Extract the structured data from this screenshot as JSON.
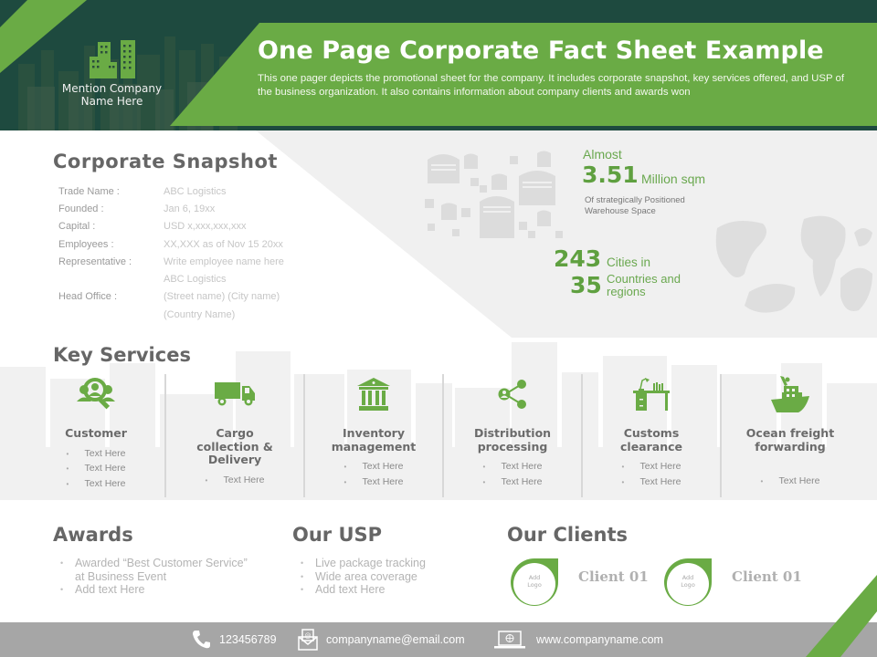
{
  "header": {
    "company_name": "Mention Company Name Here",
    "title": "One Page Corporate Fact Sheet Example",
    "intro": "This one pager depicts the promotional sheet for the company. It includes corporate snapshot, key services offered, and USP of the business organization. It also contains information about company clients and awards won",
    "logo_icon": "buildings-icon"
  },
  "snapshot": {
    "title": "Corporate  Snapshot",
    "rows": [
      {
        "label": "Trade Name :",
        "value": "ABC Logistics"
      },
      {
        "label": "Founded :",
        "value": "Jan 6, 19xx"
      },
      {
        "label": "Capital :",
        "value": "USD x,xxx,xxx,xxx"
      },
      {
        "label": "Employees :",
        "value": "XX,XXX as of Nov 15 20xx"
      },
      {
        "label": "Representative :",
        "value": "Write employee name here"
      },
      {
        "label": "",
        "value": "ABC Logistics"
      },
      {
        "label": "Head Office :",
        "value": "(Street name) (City name)"
      },
      {
        "label": "",
        "value": "(Country Name)"
      }
    ]
  },
  "stats": {
    "almost_label": "Almost",
    "warehouse_value": "3.51",
    "warehouse_unit": "Million  sqm",
    "warehouse_desc": "Of strategically Positioned Warehouse Space",
    "cities_value": "243",
    "cities_label": "Cities  in",
    "countries_value": "35",
    "countries_label": "Countries and regions",
    "warehouse_icon": "warehouse-icon",
    "map_icon": "world-map-icon"
  },
  "services": {
    "title": "Key Services",
    "items": [
      {
        "name": "Customer",
        "icon": "customer-search-icon",
        "bullets": [
          "Text Here",
          "Text Here",
          "Text Here"
        ]
      },
      {
        "name": "Cargo collection  & Delivery",
        "icon": "truck-icon",
        "bullets": [
          "Text Here"
        ]
      },
      {
        "name": "Inventory management",
        "icon": "bank-building-icon",
        "bullets": [
          "Text Here",
          "Text Here"
        ]
      },
      {
        "name": "Distribution processing",
        "icon": "share-network-icon",
        "bullets": [
          "Text Here",
          "Text Here"
        ]
      },
      {
        "name": "Customs clearance",
        "icon": "desk-icon",
        "bullets": [
          "Text Here",
          "Text Here"
        ]
      },
      {
        "name": "Ocean freight forwarding",
        "icon": "ship-icon",
        "bullets": [
          "Text Here"
        ]
      }
    ]
  },
  "awards": {
    "title": "Awards",
    "items": [
      "Awarded “Best Customer Service” at Business Event",
      "Add text Here"
    ]
  },
  "usp": {
    "title": "Our USP",
    "items": [
      "Live package tracking",
      "Wide area coverage",
      "Add text Here"
    ]
  },
  "clients": {
    "title": "Our Clients",
    "items": [
      {
        "logo_text": "Add Logo",
        "name": "Client 01"
      },
      {
        "logo_text": "Add Logo",
        "name": "Client 01"
      }
    ]
  },
  "footer": {
    "phone": "123456789",
    "email": "companyname@email.com",
    "website": "www.companyname.com"
  },
  "colors": {
    "accent_green": "#6aab45",
    "heading_gray": "#666666",
    "footer_gray": "#a6a6a6"
  }
}
